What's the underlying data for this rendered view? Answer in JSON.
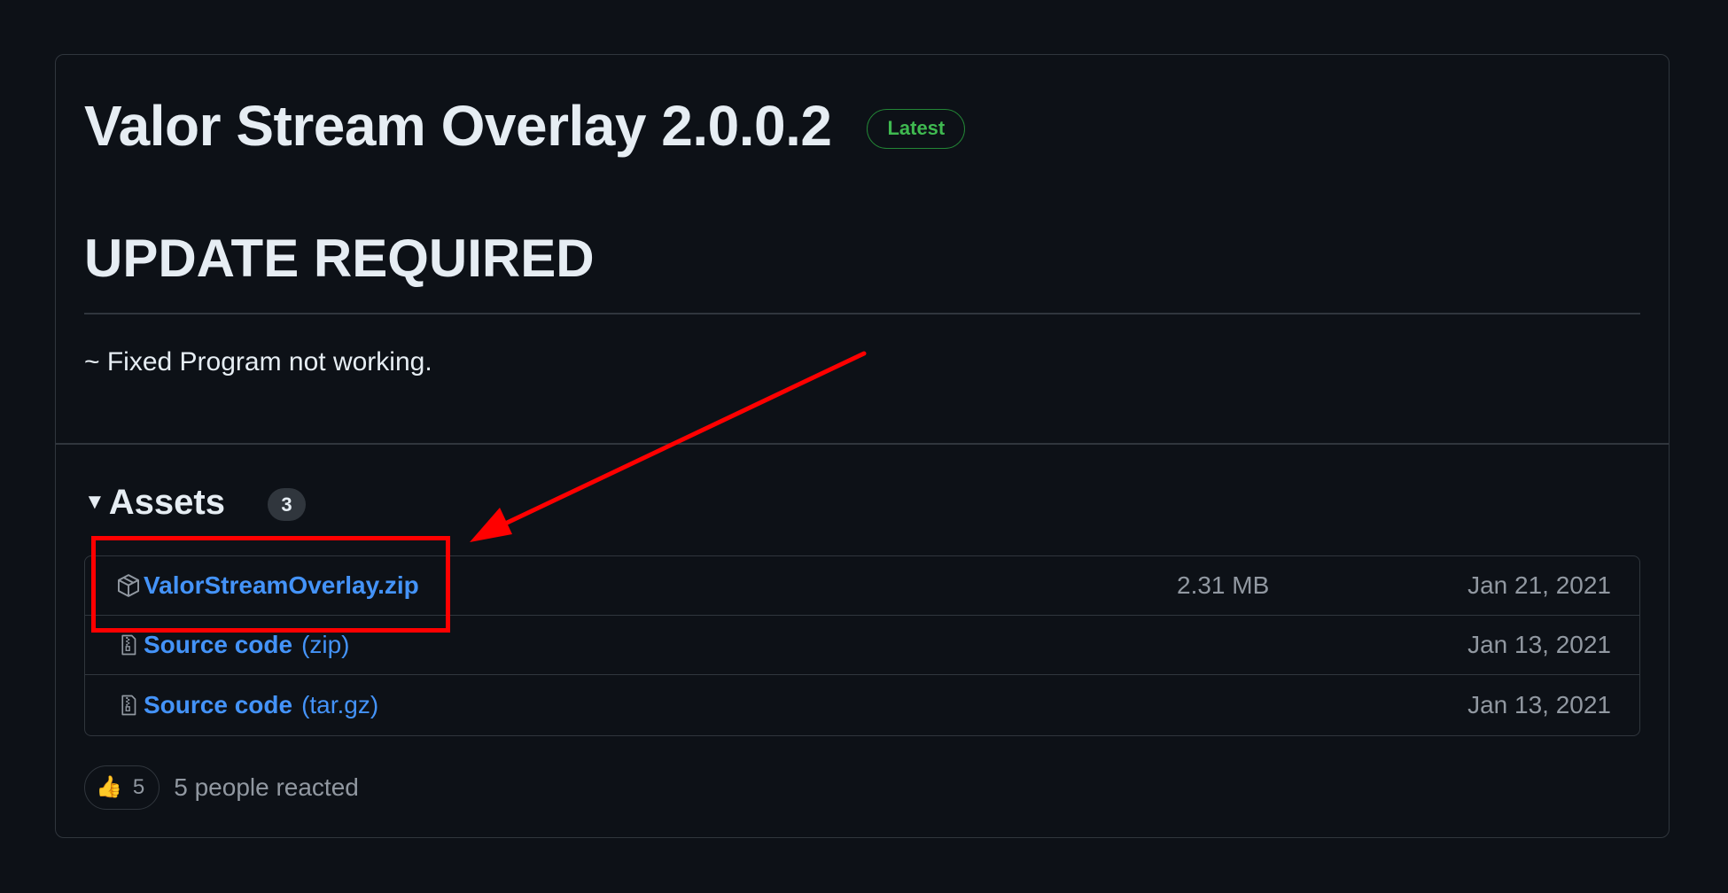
{
  "release": {
    "title": "Valor Stream Overlay 2.0.0.2",
    "badge": "Latest",
    "heading": "UPDATE REQUIRED",
    "notes": "~ Fixed Program not working."
  },
  "assets": {
    "title": "Assets",
    "count": "3",
    "items": [
      {
        "name": "ValorStreamOverlay.zip",
        "suffix": "",
        "size": "2.31 MB",
        "date": "Jan 21, 2021",
        "icon": "package-icon"
      },
      {
        "name": "Source code",
        "suffix": "(zip)",
        "size": "",
        "date": "Jan 13, 2021",
        "icon": "file-zip-icon"
      },
      {
        "name": "Source code",
        "suffix": "(tar.gz)",
        "size": "",
        "date": "Jan 13, 2021",
        "icon": "file-zip-icon"
      }
    ]
  },
  "reactions": {
    "emoji": "👍",
    "count": "5",
    "summary": "5 people reacted"
  },
  "colors": {
    "background": "#0d1117",
    "border": "#30363d",
    "link": "#4493f8",
    "latest_green": "#3fb950",
    "annotation_red": "#ff0000"
  }
}
